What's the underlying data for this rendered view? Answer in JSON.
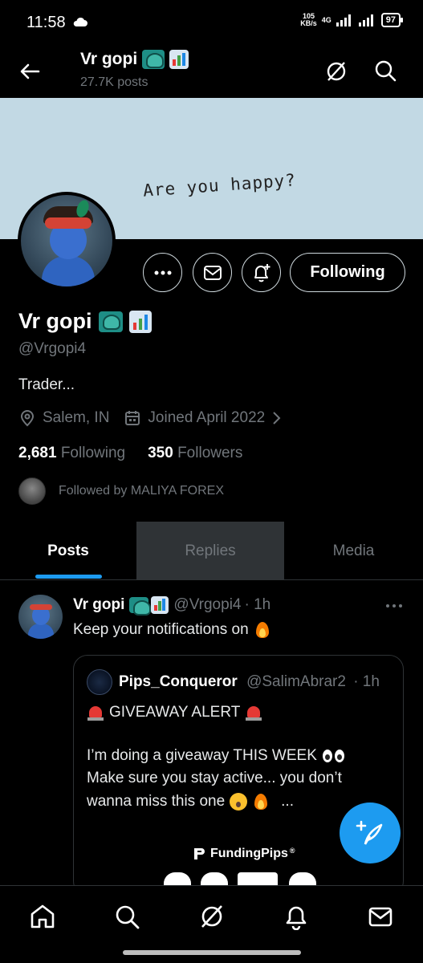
{
  "status_bar": {
    "time": "11:58",
    "net_speed_value": "105",
    "net_speed_unit": "KB/s",
    "network": "4G",
    "battery": "97"
  },
  "header": {
    "name": "Vr gopi",
    "posts": "27.7K posts"
  },
  "banner": {
    "text": "Are you happy?"
  },
  "actions": {
    "following_label": "Following"
  },
  "profile": {
    "name": "Vr gopi",
    "handle": "@Vrgopi4",
    "bio": "Trader...",
    "location": "Salem, IN",
    "joined": "Joined April 2022",
    "following_count": "2,681",
    "following_label": "Following",
    "followers_count": "350",
    "followers_label": "Followers",
    "followed_by": "Followed by MALIYA FOREX",
    "name_emojis": [
      "peacock-emoji",
      "bar-chart-emoji"
    ]
  },
  "tabs": [
    {
      "label": "Posts",
      "active": true
    },
    {
      "label": "Replies",
      "active": false
    },
    {
      "label": "Media",
      "active": false
    }
  ],
  "post": {
    "author_name": "Vr gopi",
    "author_handle": "@Vrgopi4",
    "time": "· 1h",
    "text": "Keep your notifications on",
    "quote": {
      "author_name": "Pips_Conqueror",
      "author_handle": "@SalimAbrar2",
      "time": "· 1h",
      "line1": "GIVEAWAY ALERT",
      "line2": "I’m doing a giveaway THIS WEEK",
      "line3": "Make sure you stay active... you don’t",
      "line4": "wanna miss this one",
      "line4_suffix": "...",
      "brand": "FundingPips",
      "brand_mark": "®"
    }
  },
  "colors": {
    "accent": "#1d9bf0",
    "background": "#000000",
    "secondary_text": "#71767b",
    "banner": "#c2d9e4"
  },
  "bottom_nav": [
    "home-icon",
    "search-icon",
    "grok-icon",
    "notifications-icon",
    "messages-icon"
  ]
}
